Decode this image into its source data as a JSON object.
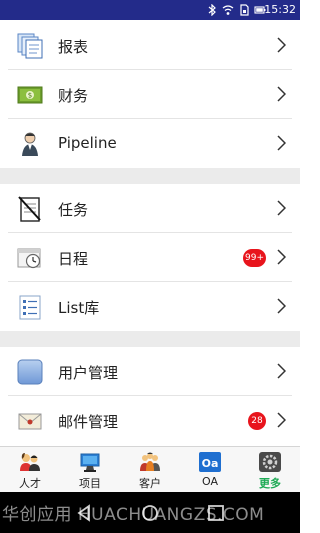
{
  "status_bar": {
    "time": "15:32",
    "icons": [
      "bluetooth-icon",
      "wifi-icon",
      "sim-icon",
      "battery-icon"
    ]
  },
  "menu_groups": [
    {
      "items": [
        {
          "label": "报表",
          "icon": "report-icon"
        },
        {
          "label": "财务",
          "icon": "finance-icon"
        },
        {
          "label": "Pipeline",
          "icon": "pipeline-icon"
        }
      ]
    },
    {
      "items": [
        {
          "label": "任务",
          "icon": "task-icon"
        },
        {
          "label": "日程",
          "icon": "calendar-icon",
          "badge": "99+"
        },
        {
          "label": "List库",
          "icon": "list-icon"
        }
      ]
    },
    {
      "items": [
        {
          "label": "用户管理",
          "icon": "user-management-icon"
        },
        {
          "label": "邮件管理",
          "icon": "mail-icon",
          "badge": "28"
        }
      ]
    }
  ],
  "tabs": [
    {
      "label": "人才",
      "icon": "people-icon"
    },
    {
      "label": "项目",
      "icon": "project-icon"
    },
    {
      "label": "客户",
      "icon": "customer-icon"
    },
    {
      "label": "OA",
      "icon": "oa-icon"
    },
    {
      "label": "更多",
      "icon": "more-icon",
      "active": true
    }
  ],
  "watermark": "华创应用 HUACHUANGZS.COM",
  "colors": {
    "status_bar": "#232b8a",
    "badge": "#e8141c",
    "active_tab": "#1eaa55",
    "section_gap": "#ebebeb"
  }
}
